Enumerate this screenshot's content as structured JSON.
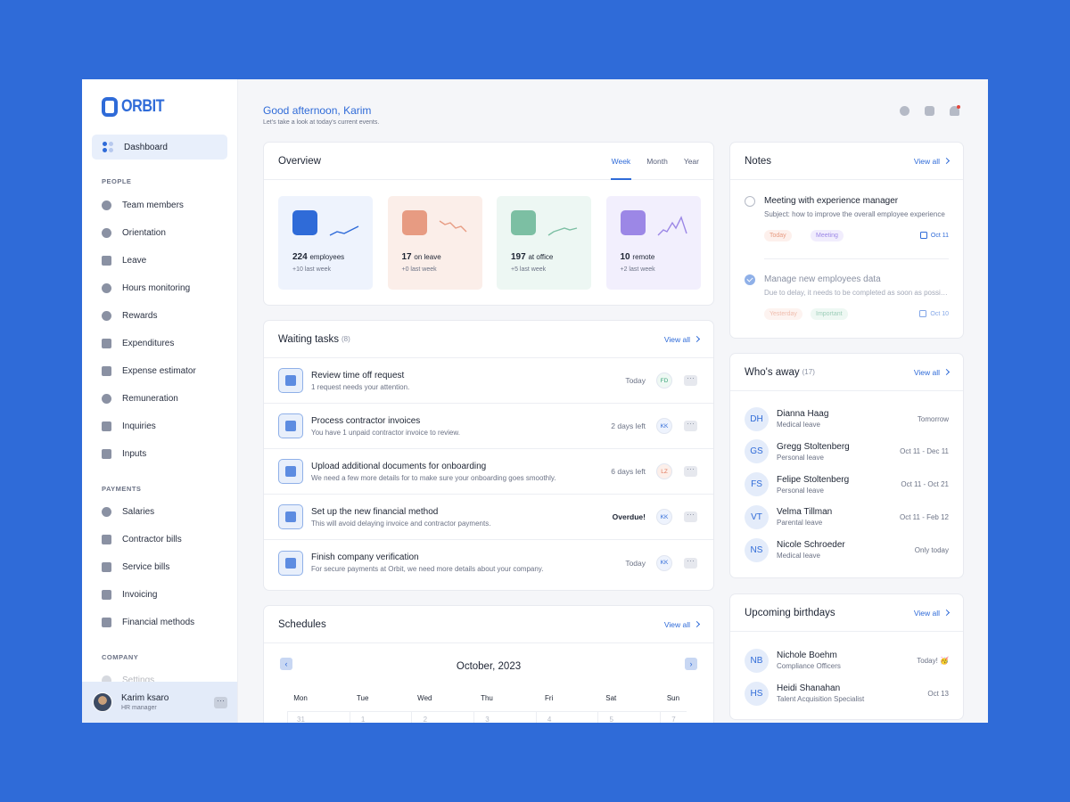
{
  "brand": {
    "name": "ORBIT"
  },
  "sidebar": {
    "active": {
      "label": "Dashboard",
      "icon": "dashboard-icon"
    },
    "sections": [
      {
        "title": "PEOPLE",
        "items": [
          {
            "label": "Team members",
            "icon": "team-icon"
          },
          {
            "label": "Orientation",
            "icon": "orientation-icon"
          },
          {
            "label": "Leave",
            "icon": "leave-icon"
          },
          {
            "label": "Hours monitoring",
            "icon": "clock-icon"
          },
          {
            "label": "Rewards",
            "icon": "rewards-icon"
          },
          {
            "label": "Expenditures",
            "icon": "expenditures-icon"
          },
          {
            "label": "Expense estimator",
            "icon": "calculator-icon"
          },
          {
            "label": "Remuneration",
            "icon": "remuneration-icon"
          },
          {
            "label": "Inquiries",
            "icon": "inbox-icon"
          },
          {
            "label": "Inputs",
            "icon": "inputs-icon"
          }
        ]
      },
      {
        "title": "PAYMENTS",
        "items": [
          {
            "label": "Salaries",
            "icon": "dollar-icon"
          },
          {
            "label": "Contractor bills",
            "icon": "card-icon"
          },
          {
            "label": "Service bills",
            "icon": "bill-icon"
          },
          {
            "label": "Invoicing",
            "icon": "invoice-icon"
          },
          {
            "label": "Financial methods",
            "icon": "bank-icon"
          }
        ]
      },
      {
        "title": "COMPANY",
        "items": [
          {
            "label": "Settings",
            "icon": "gear-icon"
          }
        ]
      }
    ],
    "user": {
      "name": "Karim ksaro",
      "role": "HR manager",
      "more": "···"
    }
  },
  "header": {
    "greeting": "Good afternoon, Karim",
    "subtitle": "Let's take a look at today's current events."
  },
  "overview": {
    "title": "Overview",
    "tabs": [
      "Week",
      "Month",
      "Year"
    ],
    "stats": [
      {
        "value": "224",
        "label": "employees",
        "sub": "+10 last week",
        "bg": "#eef3fd",
        "icon_bg": "#2f6bd8",
        "spark": "#2f6bd8"
      },
      {
        "value": "17",
        "label": "on leave",
        "sub": "+0 last week",
        "bg": "#fbeee9",
        "icon_bg": "#e79b82",
        "spark": "#e79b82"
      },
      {
        "value": "197",
        "label": "at office",
        "sub": "+5 last week",
        "bg": "#edf7f3",
        "icon_bg": "#7cbfa3",
        "spark": "#7cbfa3"
      },
      {
        "value": "10",
        "label": "remote",
        "sub": "+2 last week",
        "bg": "#f2effd",
        "icon_bg": "#9c87e6",
        "spark": "#9c87e6"
      }
    ]
  },
  "tasks": {
    "title": "Waiting tasks",
    "count": "(8)",
    "view_all": "View all",
    "items": [
      {
        "title": "Review time off request",
        "sub": "1 request needs your attention.",
        "when": "Today",
        "assignee": "FD",
        "av_color": "#3aa57a",
        "av_bg": "#eef8f3"
      },
      {
        "title": "Process contractor invoices",
        "sub": "You have 1 unpaid contractor invoice to review.",
        "when": "2 days left",
        "assignee": "KK",
        "av_color": "#2f6bd8",
        "av_bg": "#eef3fd"
      },
      {
        "title": "Upload additional documents for onboarding",
        "sub": "We need a few more details for to make sure your onboarding goes smoothly.",
        "when": "6 days left",
        "assignee": "LZ",
        "av_color": "#e07a5f",
        "av_bg": "#fcefea"
      },
      {
        "title": "Set up the new financial method",
        "sub": "This will avoid delaying invoice and contractor payments.",
        "when": "Overdue!",
        "assignee": "KK",
        "av_color": "#2f6bd8",
        "av_bg": "#eef3fd"
      },
      {
        "title": "Finish company verification",
        "sub": "For secure payments at Orbit, we need more details about your company.",
        "when": "Today",
        "assignee": "KK",
        "av_color": "#2f6bd8",
        "av_bg": "#eef3fd"
      }
    ],
    "more": "···"
  },
  "schedules": {
    "title": "Schedules",
    "view_all": "View all",
    "month": "October, 2023",
    "prev": "‹",
    "next": "›",
    "weekdays": [
      "Mon",
      "Tue",
      "Wed",
      "Thu",
      "Fri",
      "Sat",
      "Sun"
    ],
    "first_row": [
      "31",
      "1",
      "2",
      "3",
      "4",
      "5",
      "7"
    ]
  },
  "notes": {
    "title": "Notes",
    "view_all": "View all",
    "items": [
      {
        "title": "Meeting with experience manager",
        "sub": "Subject: how to improve the overall employee experience",
        "tags": [
          "Today",
          "Meeting"
        ],
        "date": "Oct 11",
        "done": false
      },
      {
        "title": "Manage new employees data",
        "sub": "Due to delay, it needs to be completed as soon as possible",
        "tags": [
          "Yesterday",
          "Important"
        ],
        "date": "Oct 10",
        "done": true
      }
    ]
  },
  "away": {
    "title": "Who's away",
    "count": "(17)",
    "view_all": "View all",
    "people": [
      {
        "initials": "DH",
        "name": "Dianna Haag",
        "reason": "Medical leave",
        "when": "Tomorrow"
      },
      {
        "initials": "GS",
        "name": "Gregg Stoltenberg",
        "reason": "Personal leave",
        "when": "Oct 11 - Dec 11"
      },
      {
        "initials": "FS",
        "name": "Felipe Stoltenberg",
        "reason": "Personal leave",
        "when": "Oct 11 - Oct 21"
      },
      {
        "initials": "VT",
        "name": "Velma Tillman",
        "reason": "Parental leave",
        "when": "Oct 11 - Feb 12"
      },
      {
        "initials": "NS",
        "name": "Nicole Schroeder",
        "reason": "Medical leave",
        "when": "Only today"
      }
    ]
  },
  "birthdays": {
    "title": "Upcoming birthdays",
    "view_all": "View all",
    "people": [
      {
        "initials": "NB",
        "name": "Nichole Boehm",
        "role": "Compliance Officers",
        "when": "Today! 🥳"
      },
      {
        "initials": "HS",
        "name": "Heidi Shanahan",
        "role": "Talent Acquisition Specialist",
        "when": "Oct 13"
      }
    ]
  }
}
